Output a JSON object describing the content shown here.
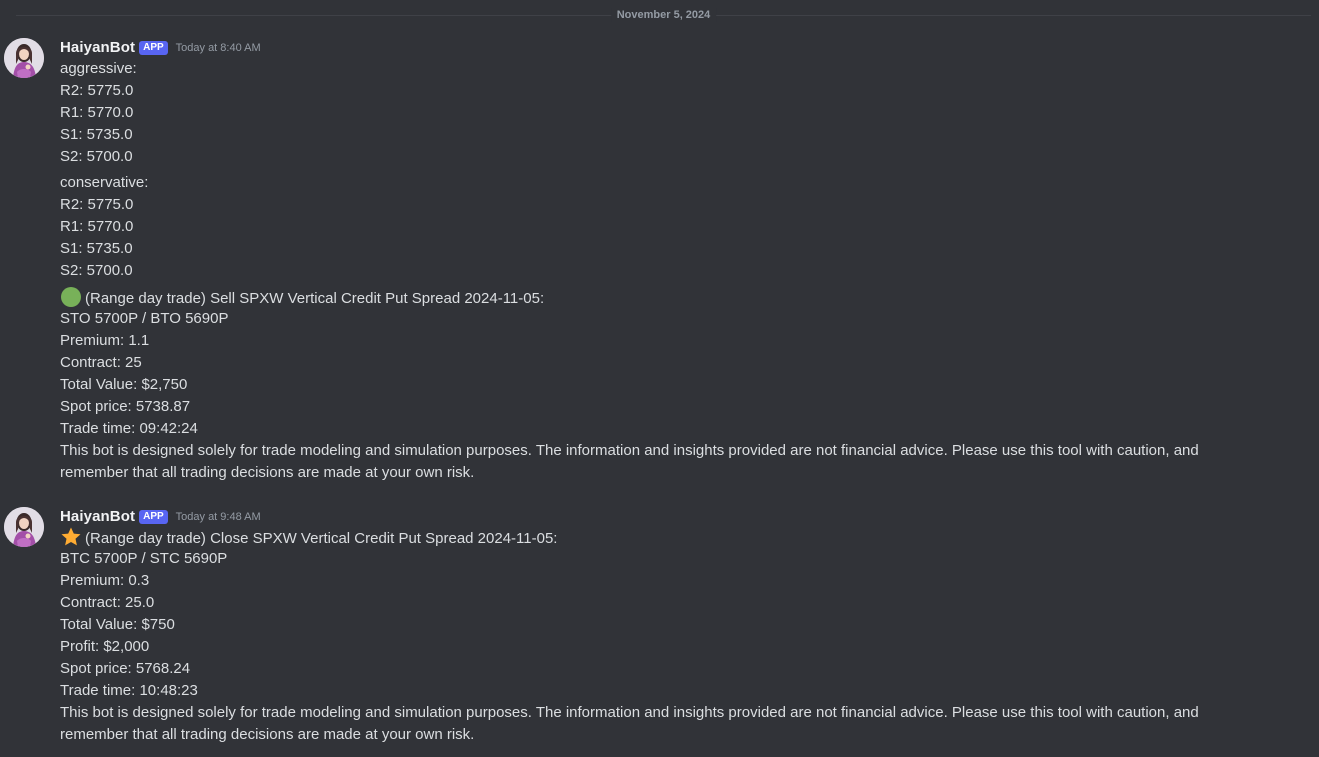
{
  "divider": {
    "date": "November 5, 2024"
  },
  "messages": [
    {
      "username": "HaiyanBot",
      "badge": "APP",
      "timestamp": "Today at 8:40 AM",
      "section1_title": "aggressive:",
      "section1_lines": [
        "R2: 5775.0",
        "R1: 5770.0",
        "S1: 5735.0",
        "S2: 5700.0"
      ],
      "section2_title": "conservative:",
      "section2_lines": [
        "R2: 5775.0",
        "R1: 5770.0",
        "S1: 5735.0",
        "S2: 5700.0"
      ],
      "trade_icon": "green-circle-icon",
      "trade_title": "(Range day trade) Sell SPXW Vertical Credit Put Spread 2024-11-05:",
      "trade_lines": [
        "STO 5700P / BTO 5690P",
        "Premium: 1.1",
        "Contract: 25",
        "Total Value: $2,750",
        "Spot price: 5738.87",
        "Trade time: 09:42:24"
      ],
      "disclaimer_line1": "This bot is designed solely for trade modeling and simulation purposes. The information and insights provided are not financial advice. Please use this tool with caution, and",
      "disclaimer_line2": "remember that all trading decisions are made at your own risk."
    },
    {
      "username": "HaiyanBot",
      "badge": "APP",
      "timestamp": "Today at 9:48 AM",
      "trade_icon": "star-icon",
      "trade_title": "(Range day trade) Close SPXW Vertical Credit Put Spread 2024-11-05:",
      "trade_lines": [
        "BTC 5700P / STC 5690P",
        "Premium: 0.3",
        "Contract: 25.0",
        "Total Value: $750",
        "Profit: $2,000",
        "Spot price: 5768.24",
        "Trade time: 10:48:23"
      ],
      "disclaimer_line1": "This bot is designed solely for trade modeling and simulation purposes. The information and insights provided are not financial advice. Please use this tool with caution, and",
      "disclaimer_line2": "remember that all trading decisions are made at your own risk."
    }
  ],
  "colors": {
    "background": "#313338",
    "text": "#dbdee1",
    "username": "#f2f3f5",
    "badge": "#5865f2",
    "muted": "#949ba4",
    "green_circle": "#78b159",
    "star": "#ffac33"
  }
}
